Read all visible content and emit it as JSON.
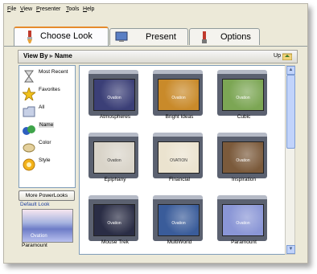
{
  "menu": [
    "File",
    "View",
    "Presenter",
    "Tools",
    "Help"
  ],
  "tabs": [
    {
      "label": "Choose Look",
      "icon": "paintbrush-icon",
      "active": true
    },
    {
      "label": "Present",
      "icon": "monitor-icon",
      "active": false
    },
    {
      "label": "Options",
      "icon": "tools-icon",
      "active": false
    }
  ],
  "viewby": {
    "label": "View By",
    "value": "Name",
    "up": "Up"
  },
  "categories": [
    {
      "label": "Most Recent",
      "icon": "hourglass-icon"
    },
    {
      "label": "Favorites",
      "icon": "star-icon"
    },
    {
      "label": "All",
      "icon": "folder-icon"
    },
    {
      "label": "Name",
      "icon": "letters-icon",
      "selected": true
    },
    {
      "label": "Color",
      "icon": "paint-palette-icon"
    },
    {
      "label": "Style",
      "icon": "sunburst-icon"
    }
  ],
  "more_button": "More PowerLooks",
  "default_look": {
    "label": "Default Look",
    "thumb_text": "Ovation",
    "name": "Paramount"
  },
  "looks": [
    {
      "name": "Atmospheres",
      "thumb_text": "Ovation",
      "bg": "#3b3f77"
    },
    {
      "name": "Bright Ideas",
      "thumb_text": "Ovation",
      "bg": "#c98a2a"
    },
    {
      "name": "Cubic",
      "thumb_text": "Ovation",
      "bg": "#7ca654"
    },
    {
      "name": "Epiphany",
      "thumb_text": "Ovation",
      "bg": "#d9d4c9"
    },
    {
      "name": "Financial",
      "thumb_text": "OVATION",
      "bg": "#ebe3cf"
    },
    {
      "name": "Inspiration",
      "thumb_text": "Ovation",
      "bg": "#7b5a3b"
    },
    {
      "name": "Mouse Trek",
      "thumb_text": "Ovation",
      "bg": "#2a2d45"
    },
    {
      "name": "MultiWorld",
      "thumb_text": "Ovation",
      "bg": "#3a5c9a"
    },
    {
      "name": "Paramount",
      "thumb_text": "Ovation",
      "bg": "#8a96d6"
    }
  ]
}
